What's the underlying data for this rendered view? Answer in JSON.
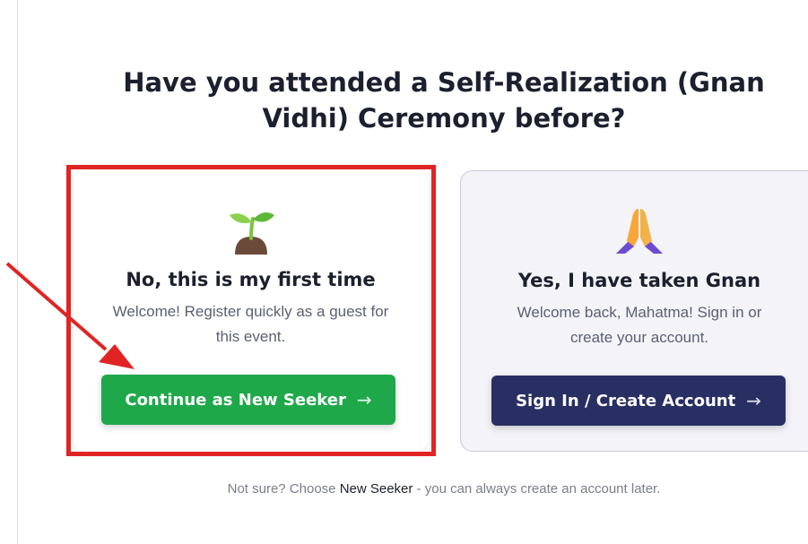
{
  "heading": "Have you attended a Self-Realization (Gnan Vidhi) Ceremony before?",
  "cards": {
    "new_seeker": {
      "icon": "seedling-icon",
      "title": "No, this is my first time",
      "description": "Welcome! Register quickly as a guest for this event.",
      "button_label": "Continue as New Seeker",
      "button_arrow": "→"
    },
    "mahatma": {
      "icon": "folded-hands-icon",
      "title": "Yes, I have taken Gnan",
      "description": "Welcome back, Mahatma! Sign in or create your account.",
      "button_label": "Sign In / Create Account",
      "button_arrow": "→"
    }
  },
  "footnote": {
    "prefix": "Not sure? Choose ",
    "emphasis": "New Seeker",
    "suffix": " - you can always create an account later."
  },
  "colors": {
    "accent_green": "#1fa84a",
    "accent_navy": "#272f63",
    "annotation_red": "#e02424"
  }
}
